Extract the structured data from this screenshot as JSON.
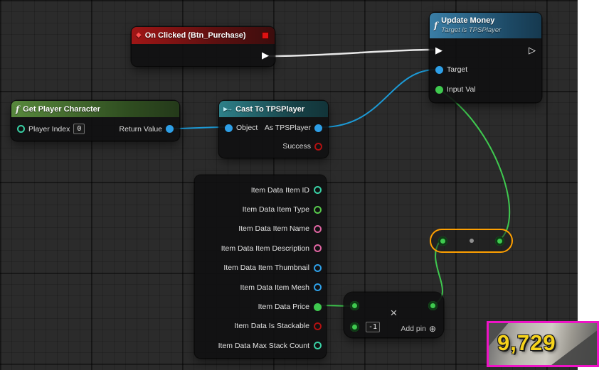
{
  "icons": {
    "event": "◆",
    "function": "f",
    "cast": "▶→",
    "exec_filled": "▶",
    "exec_hollow": "▷",
    "multiply": "×",
    "add_pin": "⊕"
  },
  "colors": {
    "exec_wire": "#e8e8e8",
    "object_wire": "#1c9ad6",
    "number_wire": "#3fc94f",
    "selection_orange": "#ffa000",
    "widget_border": "#ee13c6",
    "money_text": "#f6d31b"
  },
  "nodes": {
    "on_clicked": {
      "title": "On Clicked (Btn_Purchase)"
    },
    "update_money": {
      "title": "Update Money",
      "subtitle": "Target is TPSPlayer",
      "target_label": "Target",
      "input_val_label": "Input Val"
    },
    "get_player_character": {
      "title": "Get Player Character",
      "player_index_label": "Player Index",
      "player_index_value": "0",
      "return_value_label": "Return Value"
    },
    "cast_to_tpsplayer": {
      "title": "Cast To TPSPlayer",
      "object_label": "Object",
      "as_label": "As TPSPlayer",
      "success_label": "Success"
    },
    "break_item_data": {
      "pins": [
        {
          "label": "Item Data Item ID",
          "type": "int",
          "color": "#39d0a4",
          "connected": false
        },
        {
          "label": "Item Data Item Type",
          "type": "enum",
          "color": "#57c84c",
          "connected": false
        },
        {
          "label": "Item Data Item Name",
          "type": "text",
          "color": "#de64a1",
          "connected": false
        },
        {
          "label": "Item Data Item Description",
          "type": "text",
          "color": "#de64a1",
          "connected": false
        },
        {
          "label": "Item Data Item Thumbnail",
          "type": "object",
          "color": "#2e9fe6",
          "connected": false
        },
        {
          "label": "Item Data Item Mesh",
          "type": "object",
          "color": "#2e9fe6",
          "connected": false
        },
        {
          "label": "Item Data Price",
          "type": "int",
          "color": "#3fc94f",
          "connected": true
        },
        {
          "label": "Item Data Is Stackable",
          "type": "bool",
          "color": "#b01111",
          "connected": false
        },
        {
          "label": "Item Data Max Stack Count",
          "type": "int",
          "color": "#39d0a4",
          "connected": false
        }
      ]
    },
    "multiply": {
      "second_input_value": "-1",
      "add_pin_label": "Add pin"
    }
  },
  "hud": {
    "money": "9,729"
  }
}
